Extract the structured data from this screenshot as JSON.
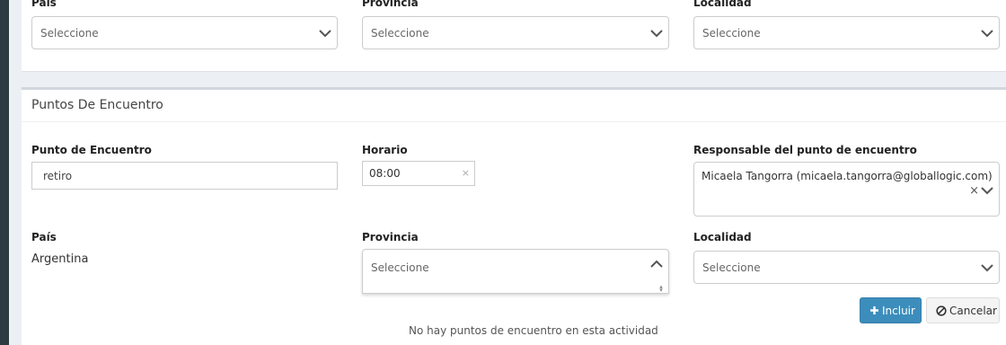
{
  "top_section": {
    "pais_label": "País",
    "provincia_label": "Provincia",
    "localidad_label": "Localidad",
    "pais_value": "Seleccione",
    "provincia_value": "Seleccione",
    "localidad_value": "Seleccione"
  },
  "meeting_points": {
    "title": "Puntos De Encuentro",
    "punto_label": "Punto de Encuentro",
    "punto_value": "retiro",
    "horario_label": "Horario",
    "horario_value": "08:00",
    "horario_clear": "×",
    "responsable_label": "Responsable del punto de encuentro",
    "responsable_value": "Micaela Tangorra (micaela.tangorra@globallogic.com)",
    "responsable_clear": "×",
    "pais_label": "País",
    "pais_value": "Argentina",
    "provincia_label": "Provincia",
    "provincia_value": "Seleccione",
    "localidad_label": "Localidad",
    "localidad_value": "Seleccione",
    "include_button": "Incluir",
    "cancel_button": "Cancelar",
    "empty_message": "No hay puntos de encuentro en esta actividad"
  },
  "icons": {
    "chevron": "chevron-down-icon",
    "plus": "plus-icon",
    "ban": "ban-icon"
  },
  "colors": {
    "primary": "#3c8dbc",
    "background": "#ecf0f5",
    "sidebar": "#2c3b41"
  }
}
